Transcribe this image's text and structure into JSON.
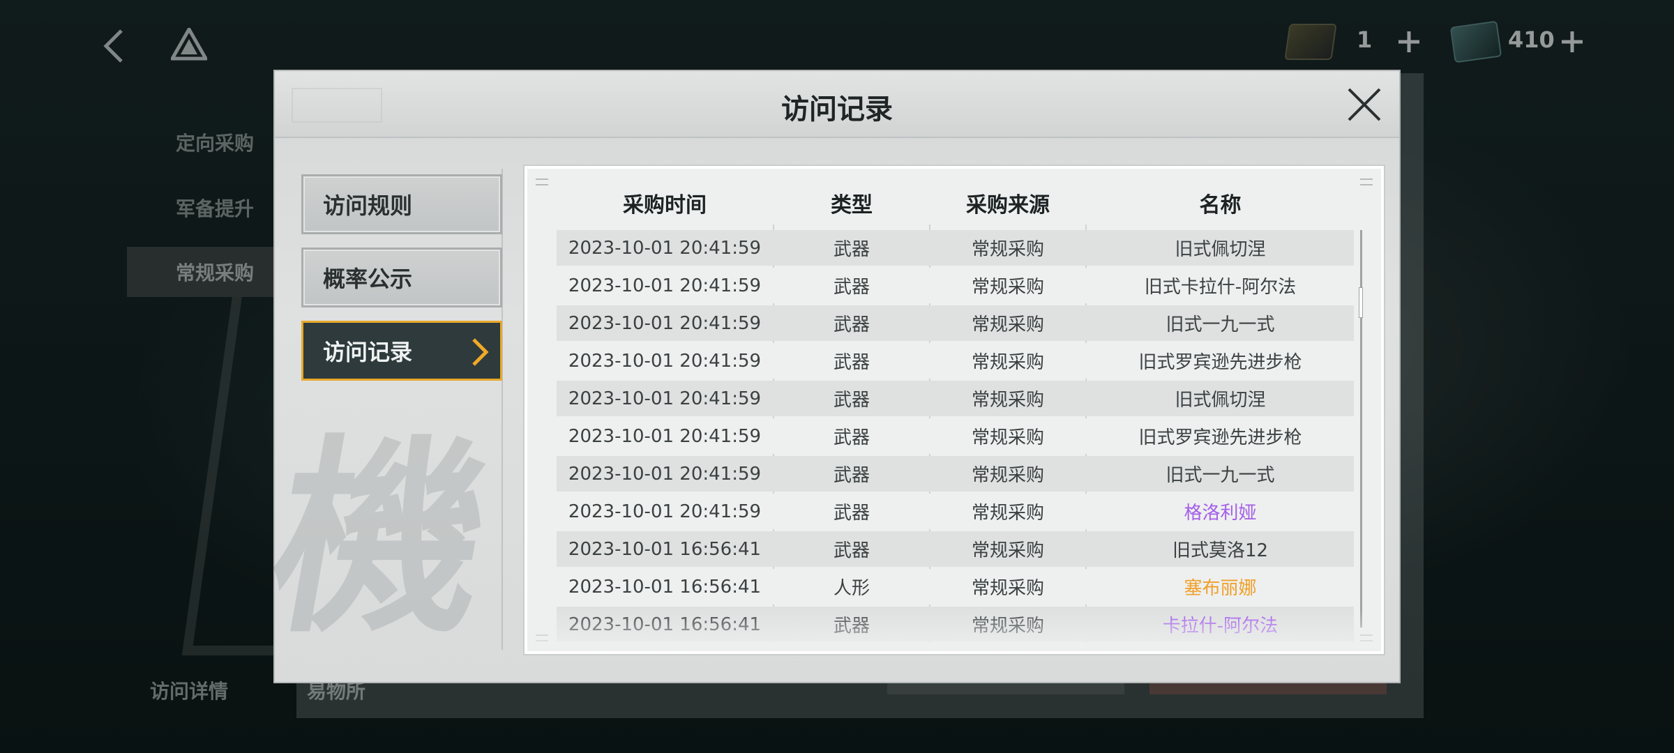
{
  "top_bar": {
    "ticket_count": "1",
    "gem_count": "410"
  },
  "background": {
    "side_items": [
      "定向采购",
      "军备提升",
      "常规采购"
    ],
    "active_side_item": "常规采购",
    "bottom_tabs": [
      "访问详情",
      "易物所"
    ]
  },
  "modal": {
    "title": "访问记录",
    "menu": [
      {
        "label": "访问规则",
        "active": false
      },
      {
        "label": "概率公示",
        "active": false
      },
      {
        "label": "访问记录",
        "active": true
      }
    ],
    "table": {
      "headers": [
        "采购时间",
        "类型",
        "采购来源",
        "名称"
      ],
      "rows": [
        {
          "time": "2023-10-01 20:41:59",
          "type": "武器",
          "source": "常规采购",
          "name": "旧式佩切涅",
          "rarity": "normal"
        },
        {
          "time": "2023-10-01 20:41:59",
          "type": "武器",
          "source": "常规采购",
          "name": "旧式卡拉什-阿尔法",
          "rarity": "normal"
        },
        {
          "time": "2023-10-01 20:41:59",
          "type": "武器",
          "source": "常规采购",
          "name": "旧式一九一式",
          "rarity": "normal"
        },
        {
          "time": "2023-10-01 20:41:59",
          "type": "武器",
          "source": "常规采购",
          "name": "旧式罗宾逊先进步枪",
          "rarity": "normal"
        },
        {
          "time": "2023-10-01 20:41:59",
          "type": "武器",
          "source": "常规采购",
          "name": "旧式佩切涅",
          "rarity": "normal"
        },
        {
          "time": "2023-10-01 20:41:59",
          "type": "武器",
          "source": "常规采购",
          "name": "旧式罗宾逊先进步枪",
          "rarity": "normal"
        },
        {
          "time": "2023-10-01 20:41:59",
          "type": "武器",
          "source": "常规采购",
          "name": "旧式一九一式",
          "rarity": "normal"
        },
        {
          "time": "2023-10-01 20:41:59",
          "type": "武器",
          "source": "常规采购",
          "name": "格洛利娅",
          "rarity": "purple"
        },
        {
          "time": "2023-10-01 16:56:41",
          "type": "武器",
          "source": "常规采购",
          "name": "旧式莫洛12",
          "rarity": "normal"
        },
        {
          "time": "2023-10-01 16:56:41",
          "type": "人形",
          "source": "常规采购",
          "name": "塞布丽娜",
          "rarity": "orange"
        },
        {
          "time": "2023-10-01 16:56:41",
          "type": "武器",
          "source": "常规采购",
          "name": "卡拉什-阿尔法",
          "rarity": "purple"
        }
      ]
    }
  },
  "colors": {
    "accent_orange": "#f0a02a",
    "rarity_purple": "#a45ee8",
    "active_menu_bg": "#2e3a3c"
  }
}
